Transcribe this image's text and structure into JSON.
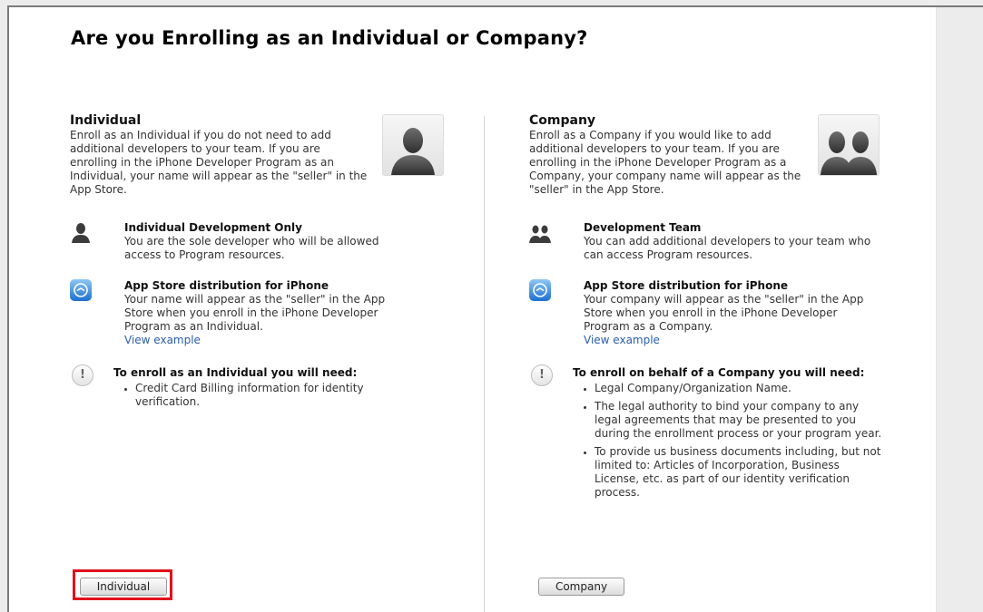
{
  "page": {
    "title": "Are you Enrolling as an Individual or Company?",
    "highlight_color": "#e3101b",
    "link_color": "#2a5db0"
  },
  "individual": {
    "heading": "Individual",
    "intro": "Enroll as an Individual if you do not need to add additional developers to your team. If you are enrolling in the iPhone Developer Program as an Individual, your name will appear as the \"seller\" in the App Store.",
    "portrait_icon": "single-person-icon",
    "feature1": {
      "icon": "single-person-icon",
      "title": "Individual Development Only",
      "text": "You are the sole developer who will be allowed access to Program resources."
    },
    "feature2": {
      "icon": "app-store-icon",
      "title": "App Store distribution for iPhone",
      "text": "Your name will appear as the \"seller\" in the App Store when you enroll in the iPhone Developer Program as an Individual.",
      "link": "View example"
    },
    "needs": {
      "icon": "exclamation-icon",
      "title": "To enroll as an Individual you will need:",
      "items": [
        "Credit Card Billing information for identity verification."
      ]
    },
    "button_label": "Individual"
  },
  "company": {
    "heading": "Company",
    "intro": "Enroll as a Company if you would like to add additional developers to your team. If you are enrolling in the iPhone Developer Program as a Company, your company name will appear as the \"seller\" in the App Store.",
    "portrait_icon": "two-people-icon",
    "feature1": {
      "icon": "two-people-icon",
      "title": "Development Team",
      "text": "You can add additional developers to your team who can access Program resources."
    },
    "feature2": {
      "icon": "app-store-icon",
      "title": "App Store distribution for iPhone",
      "text": "Your company will appear as the \"seller\" in the App Store when you enroll in the iPhone Developer Program as a Company.",
      "link": "View example"
    },
    "needs": {
      "icon": "exclamation-icon",
      "title": "To enroll on behalf of a Company you will need:",
      "items": [
        "Legal Company/Organization Name.",
        "The legal authority to bind your company to any legal agreements that may be presented to you during the enrollment process or your program year.",
        "To provide us business documents including, but not limited to: Articles of Incorporation, Business License, etc. as part of our identity verification process."
      ]
    },
    "button_label": "Company"
  }
}
